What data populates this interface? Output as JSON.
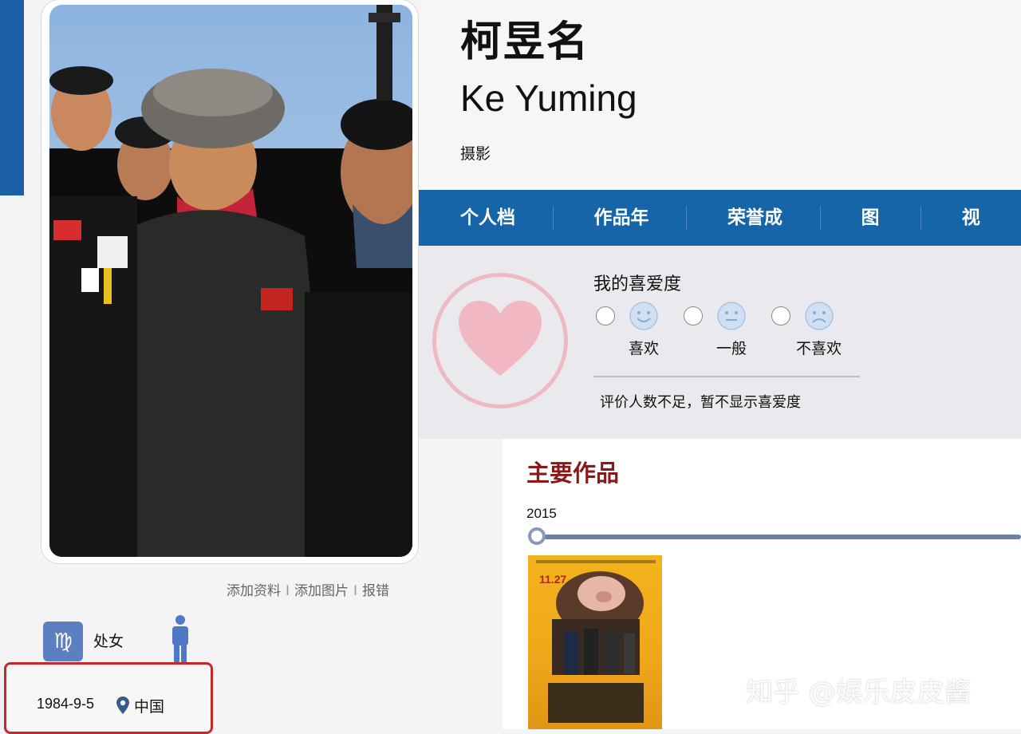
{
  "profile": {
    "name_cn": "柯昱名",
    "name_en": "Ke Yuming",
    "role": "摄影"
  },
  "nav": {
    "items": [
      {
        "label": "个人档案"
      },
      {
        "label": "作品年表"
      },
      {
        "label": "荣誉成就"
      },
      {
        "label": "图片"
      },
      {
        "label": "视频"
      }
    ]
  },
  "favor": {
    "title": "我的喜爱度",
    "options": [
      {
        "label": "喜欢",
        "icon": "happy-face-icon"
      },
      {
        "label": "一般",
        "icon": "neutral-face-icon"
      },
      {
        "label": "不喜欢",
        "icon": "sad-face-icon"
      }
    ],
    "note": "评价人数不足，暂不显示喜爱度"
  },
  "actions": {
    "add_info": "添加资料",
    "add_photo": "添加图片",
    "report": "报错",
    "separator": "I"
  },
  "info": {
    "zodiac_symbol": "♍",
    "zodiac": "处女",
    "gender_icon": "male-person-icon",
    "birth": "1984-9-5",
    "country": "中国"
  },
  "works": {
    "title": "主要作品",
    "year": "2015",
    "poster_date": "11.27"
  },
  "watermark": "知乎 @娱乐皮皮酱",
  "colors": {
    "nav_bg": "#1565a8",
    "accent_red": "#8a1a1a",
    "highlight_box": "#c62828",
    "heart": "#efb9c4"
  }
}
